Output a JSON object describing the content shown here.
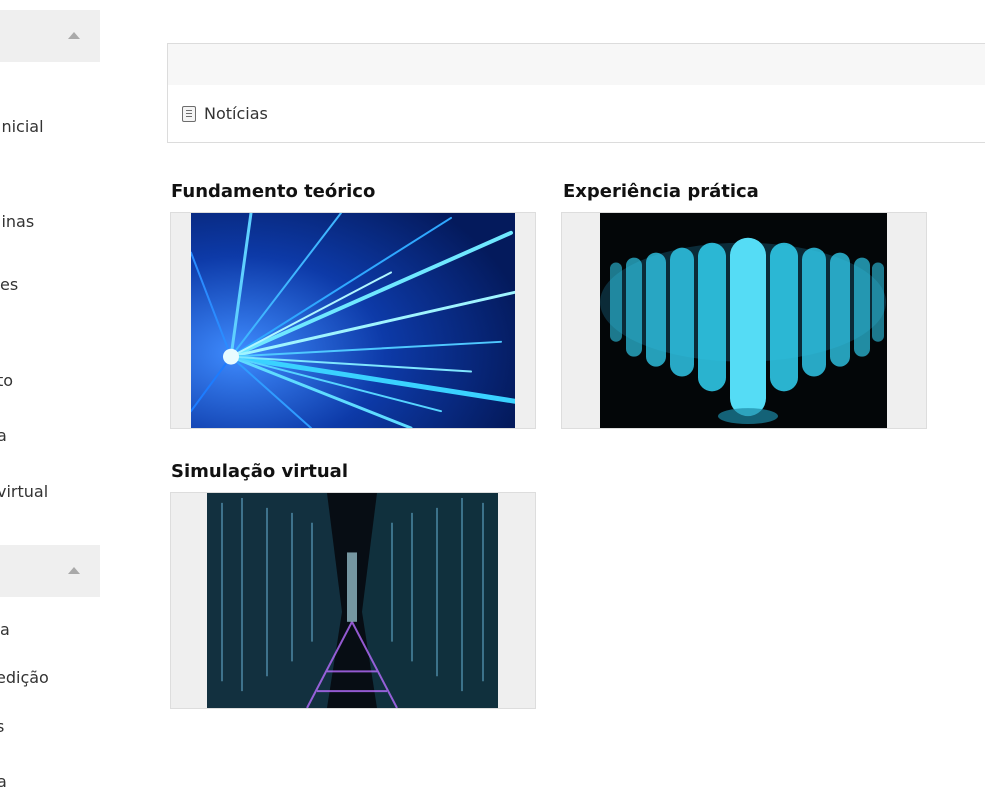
{
  "sidebar": {
    "items_top": [
      "inicial",
      "linas",
      "es",
      "to",
      "a",
      "virtual"
    ],
    "items_bottom": [
      "a",
      "edição",
      "s",
      "a"
    ]
  },
  "news": {
    "label": "Notícias",
    "icon": "document-list-icon"
  },
  "cards": [
    {
      "title": "Fundamento teórico",
      "image": "light-speed-streaks"
    },
    {
      "title": "Experiência prática",
      "image": "glowing-test-tubes"
    },
    {
      "title": "Simulação virtual",
      "image": "circuit-city-corridor"
    }
  ],
  "colors": {
    "card_bg": "#efefef",
    "sidebar_head": "#efefef",
    "accent_cyan": "#3fd8ff"
  }
}
